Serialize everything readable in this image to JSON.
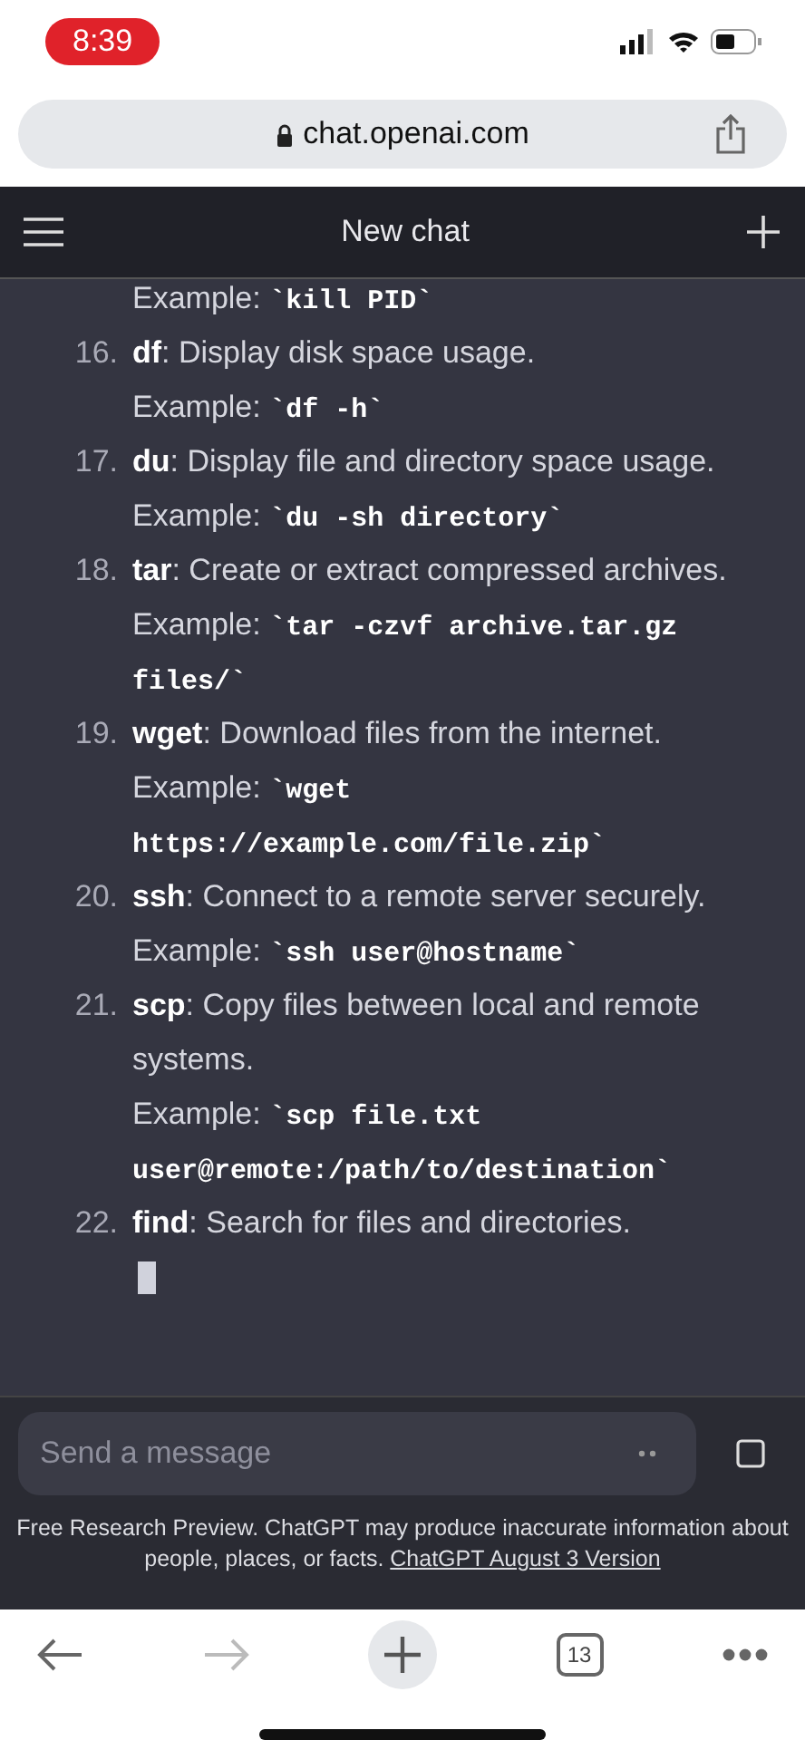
{
  "status_bar": {
    "time": "8:39"
  },
  "browser": {
    "url": "chat.openai.com",
    "tab_count": "13"
  },
  "header": {
    "title": "New chat"
  },
  "items": [
    {
      "example_label": "Example:",
      "code_lines": [
        "`kill PID`"
      ]
    },
    {
      "number": "16.",
      "command": "df",
      "description": ": Display disk space usage.",
      "example_label": "Example:",
      "code_lines": [
        "`df -h`"
      ]
    },
    {
      "number": "17.",
      "command": "du",
      "description": ": Display file and directory space usage.",
      "example_label": "Example:",
      "code_lines": [
        "`du -sh directory`"
      ]
    },
    {
      "number": "18.",
      "command": "tar",
      "description": ": Create or extract compressed archives.",
      "example_label": "Example:",
      "code_lines": [
        "`tar -czvf archive.tar.gz",
        "files/`"
      ]
    },
    {
      "number": "19.",
      "command": "wget",
      "description": ": Download files from the internet.",
      "example_label": "Example:",
      "code_lines": [
        "`wget",
        "https://example.com/file.zip`"
      ]
    },
    {
      "number": "20.",
      "command": "ssh",
      "description": ": Connect to a remote server securely.",
      "example_label": "Example:",
      "code_lines": [
        "`ssh user@hostname`"
      ]
    },
    {
      "number": "21.",
      "command": "scp",
      "description": ": Copy files between local and remote systems.",
      "example_label": "Example:",
      "code_lines": [
        "`scp file.txt",
        "user@remote:/path/to/destination`"
      ]
    },
    {
      "number": "22.",
      "command": "find",
      "description": ": Search for files and directories."
    }
  ],
  "composer": {
    "placeholder": "Send a message"
  },
  "disclaimer": {
    "text": "Free Research Preview. ChatGPT may produce inaccurate information about people, places, or facts.",
    "link": "ChatGPT August 3 Version"
  }
}
